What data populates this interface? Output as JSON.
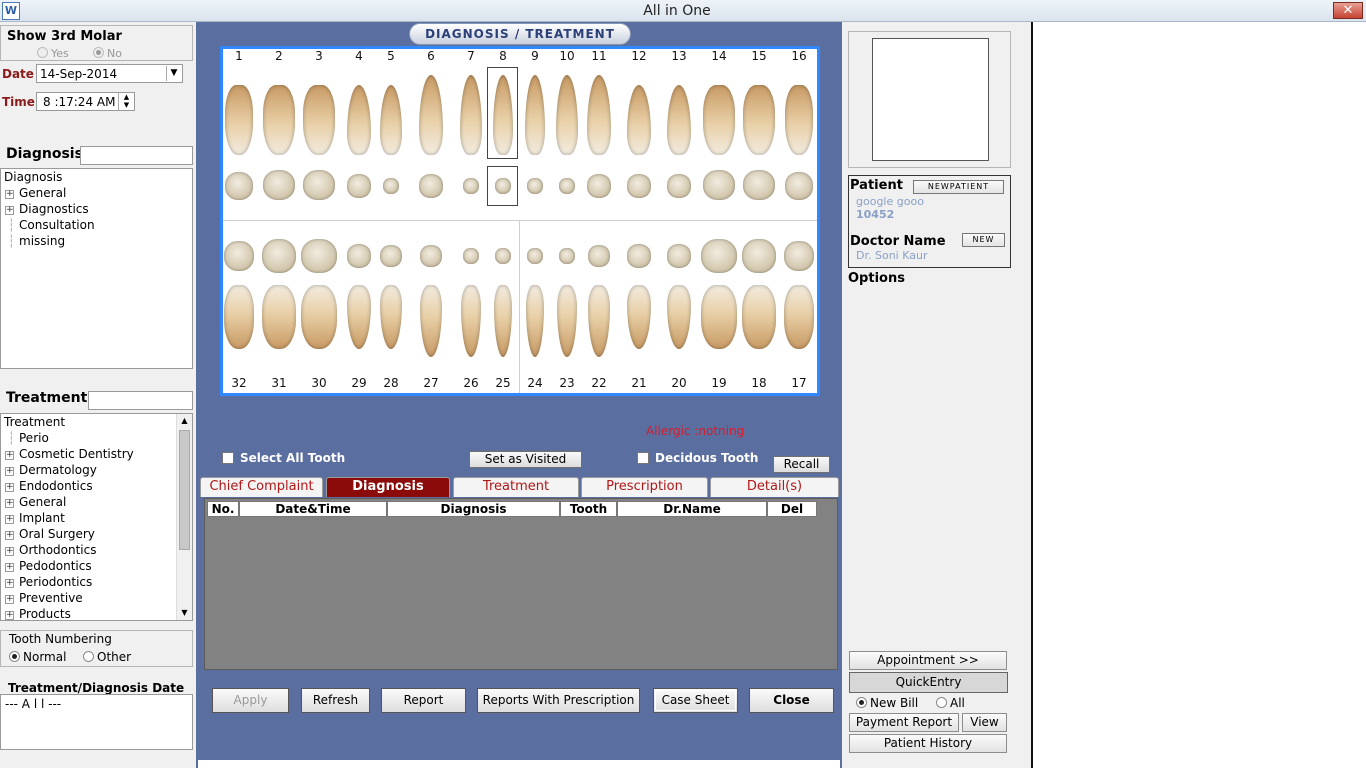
{
  "window": {
    "title": "All in One",
    "close_glyph": "✕",
    "icon": "tooth-app-icon"
  },
  "left": {
    "show_molar_label": "Show 3rd Molar",
    "yes": "Yes",
    "no": "No",
    "date_label": "Date",
    "date_value": "14-Sep-2014",
    "time_label": "Time",
    "time_value": "8 :17:24 AM",
    "diagnosis_label": "Diagnosis",
    "diagnosis_search": "",
    "diagnosis_tree": [
      {
        "label": "Diagnosis",
        "kind": "root"
      },
      {
        "label": "General",
        "kind": "node"
      },
      {
        "label": "Diagnostics",
        "kind": "node"
      },
      {
        "label": "Consultation",
        "kind": "leaf"
      },
      {
        "label": "missing",
        "kind": "leaf"
      }
    ],
    "treatment_label": "Treatment",
    "treatment_search": "",
    "treatment_tree": [
      {
        "label": "Treatment",
        "kind": "root"
      },
      {
        "label": "Perio",
        "kind": "leaf"
      },
      {
        "label": "Cosmetic Dentistry",
        "kind": "node"
      },
      {
        "label": "Dermatology",
        "kind": "node"
      },
      {
        "label": "Endodontics",
        "kind": "node"
      },
      {
        "label": "General",
        "kind": "node"
      },
      {
        "label": "Implant",
        "kind": "node"
      },
      {
        "label": "Oral Surgery",
        "kind": "node"
      },
      {
        "label": "Orthodontics",
        "kind": "node"
      },
      {
        "label": "Pedodontics",
        "kind": "node"
      },
      {
        "label": "Periodontics",
        "kind": "node"
      },
      {
        "label": "Preventive",
        "kind": "node"
      },
      {
        "label": "Products",
        "kind": "node"
      }
    ],
    "numbering_label": "Tooth Numbering",
    "normal": "Normal",
    "other": "Other",
    "dates_label": "Treatment/Diagnosis Date",
    "dates_value": "--- A l l ---"
  },
  "center": {
    "header": "DIAGNOSIS / TREATMENT",
    "upper_numbers": [
      "1",
      "2",
      "3",
      "4",
      "5",
      "6",
      "7",
      "8",
      "9",
      "10",
      "11",
      "12",
      "13",
      "14",
      "15",
      "16"
    ],
    "lower_numbers": [
      "32",
      "31",
      "30",
      "29",
      "28",
      "27",
      "26",
      "25",
      "24",
      "23",
      "22",
      "21",
      "20",
      "19",
      "18",
      "17"
    ],
    "allergic": "Allergic :notning",
    "select_all": "Select All Tooth",
    "set_visited": "Set as Visited",
    "decidous": "Decidous Tooth",
    "recall": "Recall",
    "tabs": [
      "Chief Complaint",
      "Diagnosis",
      "Treatment",
      "Prescription",
      "Detail(s)"
    ],
    "active_tab": "Diagnosis",
    "columns": [
      "No.",
      "Date&Time",
      "Diagnosis",
      "Tooth",
      "Dr.Name",
      "Del"
    ],
    "buttons": {
      "apply": "Apply",
      "refresh": "Refresh",
      "report": "Report",
      "reports_rx": "Reports  With Prescription",
      "case_sheet": "Case Sheet",
      "close": "Close"
    }
  },
  "right": {
    "patient_label": "Patient",
    "new_patient": "NEWPATIENT",
    "patient_name": "google gooo",
    "patient_id": "10452",
    "doctor_label": "Doctor Name",
    "new_doctor": "NEW",
    "doctor_name": "Dr. Soni Kaur",
    "options_label": "Options",
    "appointment": "Appointment >>",
    "quick_entry": "QuickEntry",
    "new_bill": "New Bill",
    "all": "All",
    "payment_report": "Payment Report",
    "view": "View",
    "patient_history": "Patient History"
  }
}
